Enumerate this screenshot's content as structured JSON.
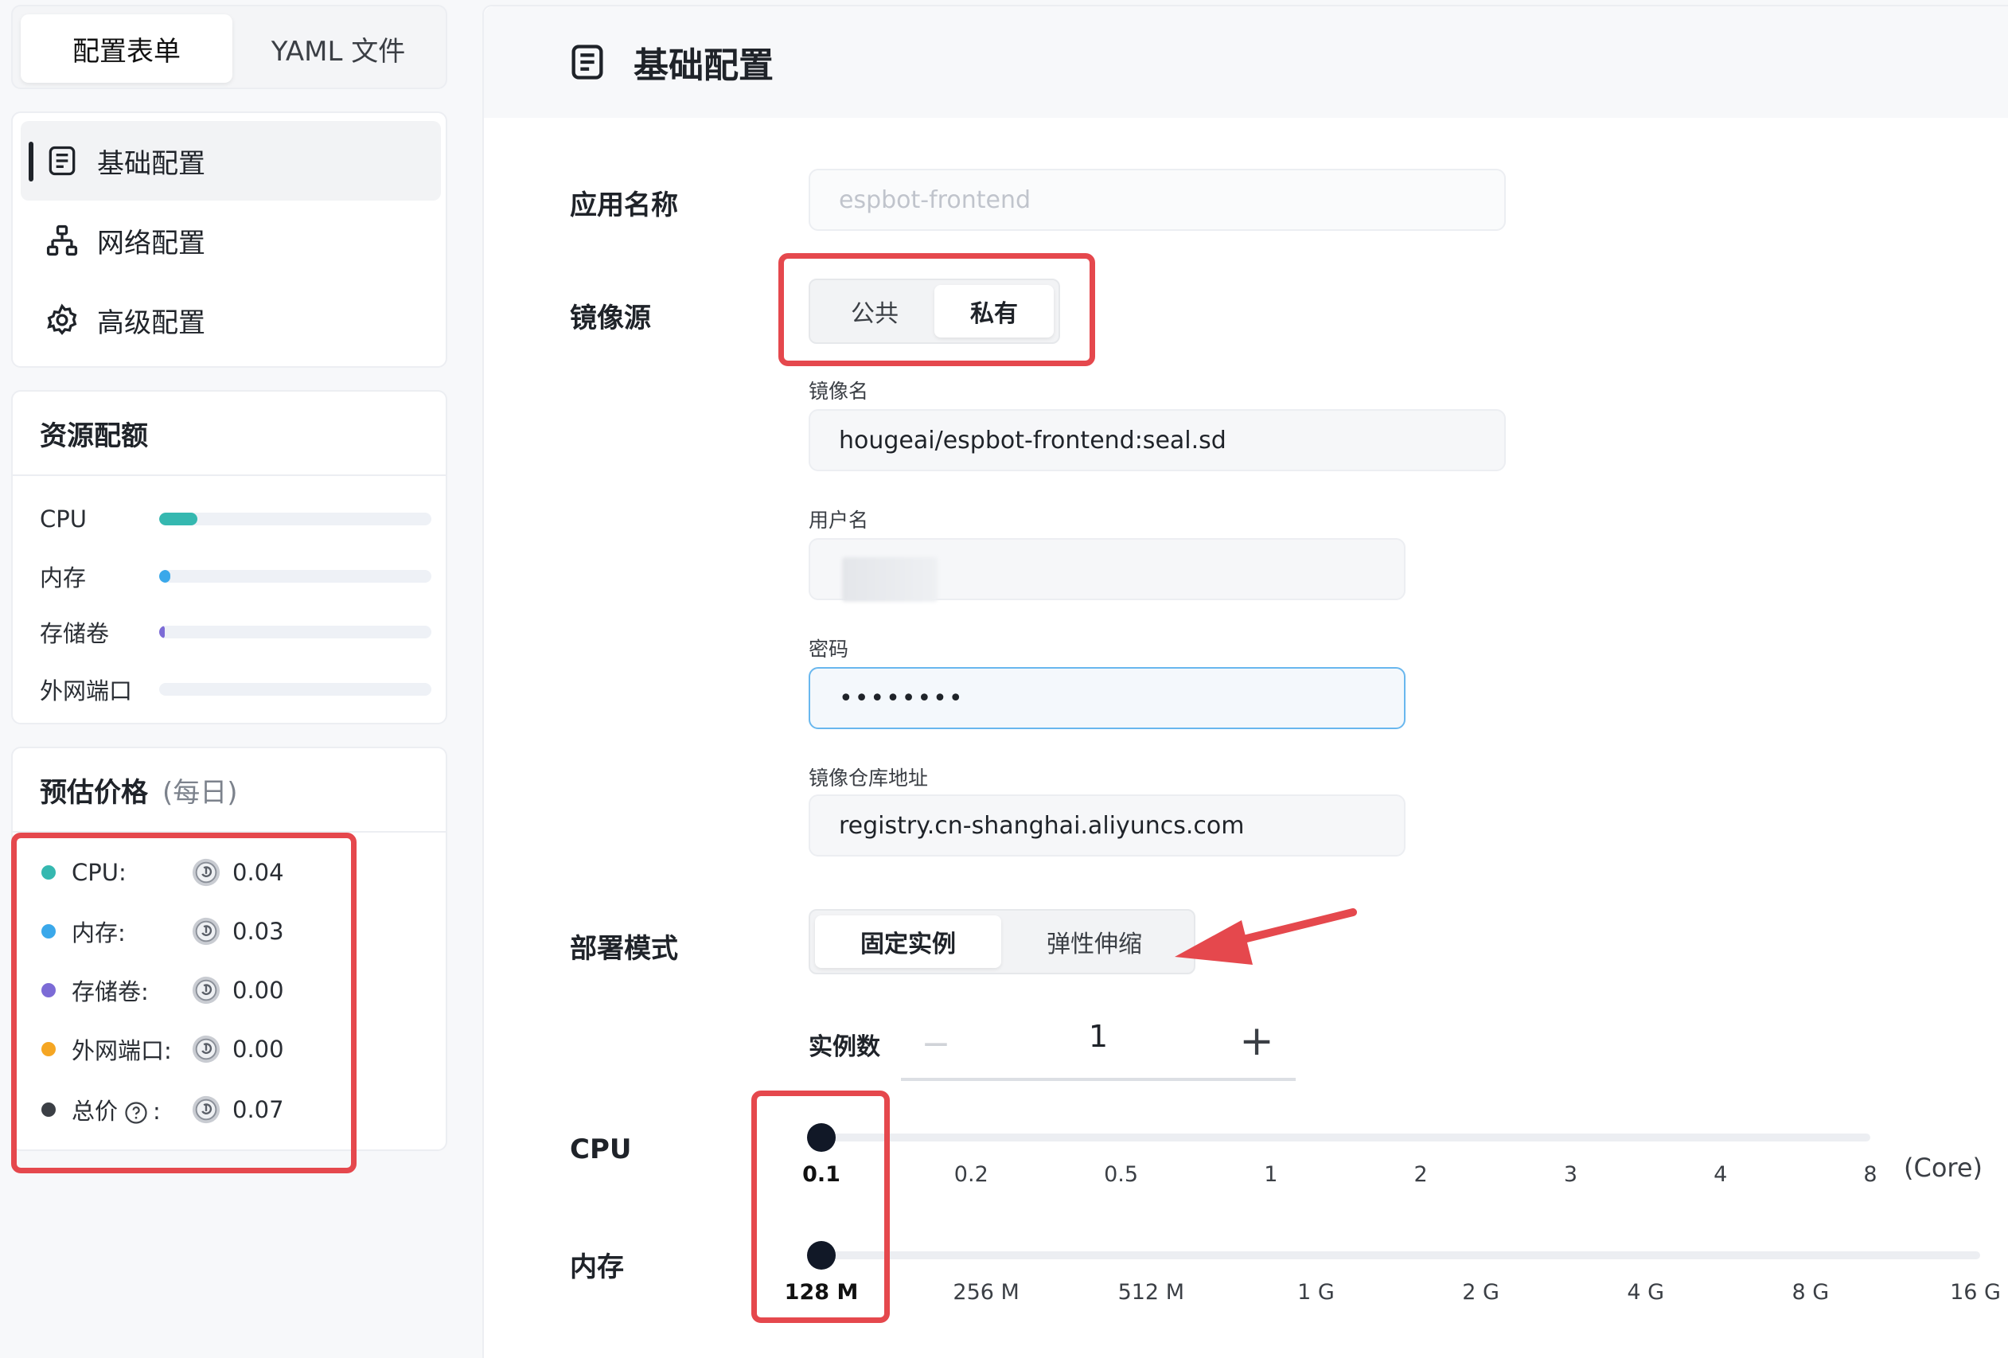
{
  "sidebar": {
    "tabs": [
      {
        "label": "配置表单",
        "active": true
      },
      {
        "label": "YAML 文件",
        "active": false
      }
    ],
    "nav": [
      {
        "label": "基础配置",
        "icon": "document-list-icon",
        "active": true
      },
      {
        "label": "网络配置",
        "icon": "network-icon",
        "active": false
      },
      {
        "label": "高级配置",
        "icon": "gear-icon",
        "active": false
      }
    ],
    "quota": {
      "title": "资源配额",
      "items": [
        {
          "label": "CPU",
          "fraction": 0.14,
          "color": "#35b8b0"
        },
        {
          "label": "内存",
          "fraction": 0.04,
          "color": "#3aa8ea"
        },
        {
          "label": "存储卷",
          "fraction": 0.02,
          "color": "#7c6bd6"
        },
        {
          "label": "外网端口",
          "fraction": 0.0,
          "color": "#f5a623"
        }
      ]
    },
    "price": {
      "title": "预估价格",
      "subtitle": "(每日)",
      "items": [
        {
          "label": "CPU:",
          "value": "0.04",
          "color": "#35b8b0"
        },
        {
          "label": "内存:",
          "value": "0.03",
          "color": "#3aa8ea"
        },
        {
          "label": "存储卷:",
          "value": "0.00",
          "color": "#7c6bd6"
        },
        {
          "label": "外网端口:",
          "value": "0.00",
          "color": "#f5a623"
        },
        {
          "label": "总价",
          "suffix": ":",
          "value": "0.07",
          "color": "#3b3f45"
        }
      ]
    }
  },
  "main": {
    "title": "基础配置",
    "app_name": {
      "label": "应用名称",
      "placeholder": "espbot-frontend"
    },
    "image_source": {
      "label": "镜像源",
      "options": [
        {
          "label": "公共",
          "active": false
        },
        {
          "label": "私有",
          "active": true
        }
      ]
    },
    "image_name": {
      "label": "镜像名",
      "value": "hougeai/espbot-frontend:seal.sd"
    },
    "username": {
      "label": "用户名",
      "value": ""
    },
    "password": {
      "label": "密码",
      "value": "••••••••"
    },
    "registry": {
      "label": "镜像仓库地址",
      "value": "registry.cn-shanghai.aliyuncs.com"
    },
    "deploy_mode": {
      "label": "部署模式",
      "options": [
        {
          "label": "固定实例",
          "active": true
        },
        {
          "label": "弹性伸缩",
          "active": false
        }
      ]
    },
    "instances": {
      "label": "实例数",
      "minus": "−",
      "value": "1",
      "plus": "+"
    },
    "cpu": {
      "label": "CPU",
      "ticks": [
        "0.1",
        "0.2",
        "0.5",
        "1",
        "2",
        "3",
        "4",
        "8"
      ],
      "selected": "0.1",
      "unit": "(Core)"
    },
    "memory": {
      "label": "内存",
      "ticks": [
        "128 M",
        "256 M",
        "512 M",
        "1 G",
        "2 G",
        "4 G",
        "8 G",
        "16 G"
      ],
      "selected": "128 M"
    },
    "colors": {
      "highlight": "#e5484d",
      "focus": "#69b7ee",
      "thumb": "#111827"
    }
  }
}
